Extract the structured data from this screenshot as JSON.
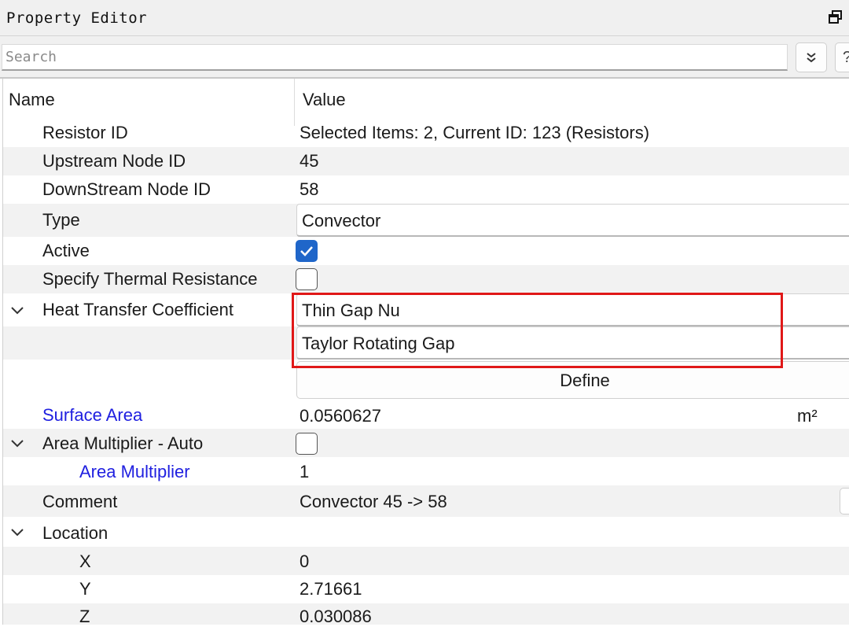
{
  "panel": {
    "title": "Property Editor",
    "float_icon": "float-window-icon"
  },
  "search": {
    "placeholder": "Search",
    "value": "",
    "expand_icon": "double-chevron-down-icon",
    "help_label": "?"
  },
  "columns": {
    "name": "Name",
    "value": "Value"
  },
  "rows": {
    "resistor_id": {
      "name": "Resistor ID",
      "value": "Selected Items: 2, Current ID: 123 (Resistors)"
    },
    "upstream": {
      "name": "Upstream Node ID",
      "value": "45"
    },
    "downstream": {
      "name": "DownStream Node ID",
      "value": "58"
    },
    "type": {
      "name": "Type",
      "value": "Convector"
    },
    "active": {
      "name": "Active",
      "checked": true
    },
    "specify_thermal": {
      "name": "Specify Thermal Resistance",
      "checked": false
    },
    "htc": {
      "name": "Heat Transfer Coefficient",
      "value1": "Thin Gap Nu",
      "value2": "Taylor Rotating Gap",
      "define_label": "Define"
    },
    "surface_area": {
      "name": "Surface Area",
      "value": "0.0560627",
      "unit": "m²"
    },
    "area_mult_auto": {
      "name": "Area Multiplier - Auto",
      "checked": false
    },
    "area_mult": {
      "name": "Area Multiplier",
      "value": "1"
    },
    "comment": {
      "name": "Comment",
      "value": "Convector 45 -> 58"
    },
    "location": {
      "name": "Location"
    },
    "x": {
      "name": "X",
      "value": "0"
    },
    "y": {
      "name": "Y",
      "value": "2.71661"
    },
    "z": {
      "name": "Z",
      "value": "0.030086"
    }
  },
  "colors": {
    "link": "#2020e0",
    "highlight": "#e01818",
    "checkbox_checked": "#1f66c9"
  }
}
